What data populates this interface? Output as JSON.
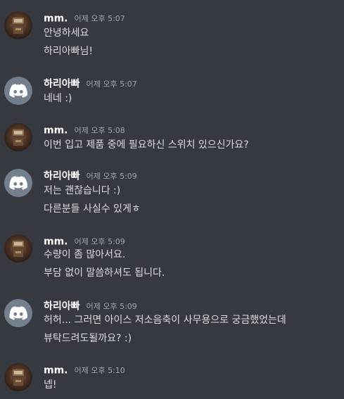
{
  "messages": [
    {
      "author": "mm.",
      "time": "어제 오후 5:07",
      "avatar": "photo",
      "lines": [
        "안녕하세요",
        "하리아빠님!"
      ]
    },
    {
      "author": "하리아빠",
      "time": "어제 오후 5:07",
      "avatar": "discord-logo",
      "lines": [
        "네네 :)"
      ]
    },
    {
      "author": "mm.",
      "time": "어제 오후 5:08",
      "avatar": "photo",
      "lines": [
        "이번 입고 제품 중에 필요하신 스위치 있으신가요?"
      ]
    },
    {
      "author": "하리아빠",
      "time": "어제 오후 5:09",
      "avatar": "discord-logo",
      "lines": [
        "저는 괜찮습니다 :)",
        "다른분들 사실수 있게ㅎ"
      ]
    },
    {
      "author": "mm.",
      "time": "어제 오후 5:09",
      "avatar": "photo",
      "lines": [
        "수량이 좀 많아서요.",
        "부담 없이 말씀하셔도 됩니다."
      ]
    },
    {
      "author": "하리아빠",
      "time": "어제 오후 5:09",
      "avatar": "discord-logo",
      "lines": [
        "허허... 그러면 아이스 저소음축이 사무용으로 궁금했었는데",
        "뷰탁드려도될까요? :)"
      ]
    },
    {
      "author": "mm.",
      "time": "어제 오후 5:10",
      "avatar": "photo",
      "lines": [
        "넵!"
      ]
    }
  ],
  "colors": {
    "background": "#36393f",
    "username": "#ffffff",
    "timestamp": "#a3a6aa",
    "text": "#dcddde",
    "discord_avatar_bg": "#747f8d"
  }
}
